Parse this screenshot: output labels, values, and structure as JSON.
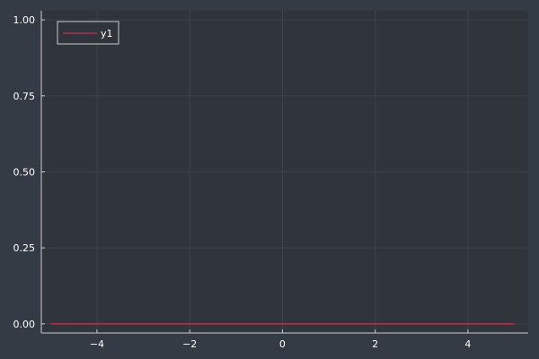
{
  "chart_data": {
    "type": "line",
    "title": "",
    "xlabel": "",
    "ylabel": "",
    "xlim": [
      -5.2,
      5.3
    ],
    "ylim": [
      -0.03,
      1.03
    ],
    "xticks": [
      -4,
      -2,
      0,
      2,
      4
    ],
    "xtick_labels": [
      "−4",
      "−2",
      "0",
      "2",
      "4"
    ],
    "yticks": [
      0,
      0.25,
      0.5,
      0.75,
      1
    ],
    "ytick_labels": [
      "0.00",
      "0.25",
      "0.50",
      "0.75",
      "1.00"
    ],
    "grid": true,
    "legend_position": "top-left",
    "series": [
      {
        "name": "y1",
        "color": "#e2345d",
        "x": [
          -5,
          5
        ],
        "y": [
          0,
          0
        ]
      }
    ]
  },
  "colors": {
    "page_background": "#353b45",
    "plot_background": "#30343b",
    "axis": "#c8ccd2",
    "grid": "#3d424b",
    "text": "#ffffff"
  }
}
